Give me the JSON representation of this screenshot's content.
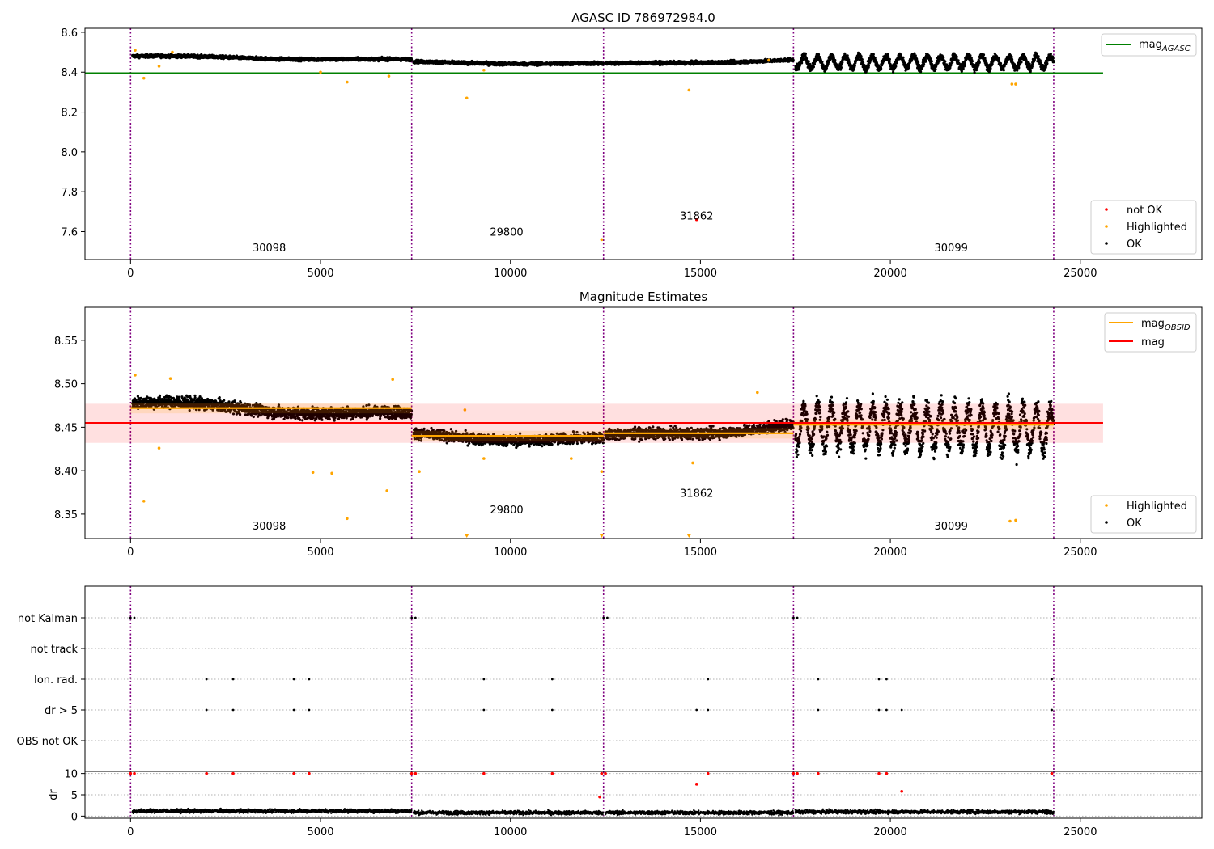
{
  "chart_data": [
    {
      "type": "scatter",
      "title": "AGASC ID 786972984.0",
      "xlim": [
        -1200,
        28200
      ],
      "ylim": [
        7.46,
        8.62
      ],
      "xticks": [
        0,
        5000,
        10000,
        15000,
        20000,
        25000
      ],
      "yticks": [
        7.6,
        7.8,
        8.0,
        8.2,
        8.4,
        8.6
      ],
      "ytick_labels": [
        "7.6",
        "7.8",
        "8.0",
        "8.2",
        "8.4",
        "8.6"
      ],
      "mag_agasc": 8.395,
      "mag_agasc_x": [
        -1200,
        25600
      ],
      "obsid_boundaries": [
        0,
        7400,
        12450,
        17450,
        24300
      ],
      "obsid_labels": [
        {
          "x": 3650,
          "y": 7.5,
          "text": "30098"
        },
        {
          "x": 9900,
          "y": 7.58,
          "text": "29800"
        },
        {
          "x": 14900,
          "y": 7.66,
          "text": "31862"
        },
        {
          "x": 21600,
          "y": 7.5,
          "text": "30099"
        }
      ],
      "series": [
        {
          "name": "mag",
          "sub": "AGASC",
          "kind": "line",
          "color": "#008000"
        },
        {
          "name": "not OK",
          "kind": "points",
          "color": "#ff0000",
          "points": [
            [
              14900,
              7.66
            ]
          ]
        },
        {
          "name": "Highlighted",
          "kind": "points",
          "color": "#ffa500",
          "points": [
            [
              120,
              8.51
            ],
            [
              350,
              8.37
            ],
            [
              750,
              8.43
            ],
            [
              1100,
              8.5
            ],
            [
              5000,
              8.4
            ],
            [
              5700,
              8.35
            ],
            [
              6800,
              8.38
            ],
            [
              8850,
              8.27
            ],
            [
              9300,
              8.41
            ],
            [
              12400,
              7.56
            ],
            [
              14700,
              8.31
            ],
            [
              16800,
              8.46
            ],
            [
              23200,
              8.34
            ],
            [
              23300,
              8.34
            ]
          ]
        },
        {
          "name": "OK",
          "kind": "trend",
          "color": "#000000",
          "segments": [
            {
              "x0": 50,
              "x1": 7400,
              "y0": 8.48,
              "y1": 8.46,
              "spread": 0.025
            },
            {
              "x0": 7450,
              "x1": 12450,
              "y0": 8.45,
              "y1": 8.44,
              "spread": 0.025
            },
            {
              "x0": 12500,
              "x1": 17450,
              "y0": 8.44,
              "y1": 8.46,
              "spread": 0.025
            },
            {
              "x0": 17500,
              "x1": 24300,
              "y0": 8.45,
              "y1": 8.45,
              "spread": 0.05,
              "oscillate": true
            }
          ]
        }
      ],
      "legend_top": [
        {
          "label": "mag",
          "sub": "AGASC",
          "color": "#008000"
        }
      ],
      "legend_bottom": [
        {
          "label": "not OK",
          "color": "#ff0000"
        },
        {
          "label": "Highlighted",
          "color": "#ffa500"
        },
        {
          "label": "OK",
          "color": "#000000"
        }
      ]
    },
    {
      "type": "scatter",
      "title": "Magnitude Estimates",
      "xlim": [
        -1200,
        28200
      ],
      "ylim": [
        8.322,
        8.588
      ],
      "xticks": [
        0,
        5000,
        10000,
        15000,
        20000,
        25000
      ],
      "yticks": [
        8.35,
        8.4,
        8.45,
        8.5,
        8.55
      ],
      "ytick_labels": [
        "8.35",
        "8.40",
        "8.45",
        "8.50",
        "8.55"
      ],
      "mag": 8.455,
      "mag_band": [
        8.432,
        8.477
      ],
      "mag_x": [
        -1200,
        25600
      ],
      "mag_obsid": [
        {
          "x0": 0,
          "x1": 7400,
          "y": 8.472
        },
        {
          "x0": 7400,
          "x1": 12450,
          "y": 8.44
        },
        {
          "x0": 12450,
          "x1": 17450,
          "y": 8.443
        },
        {
          "x0": 17450,
          "x1": 24300,
          "y": 8.453
        }
      ],
      "obsid_boundaries": [
        0,
        7400,
        12450,
        17450,
        24300
      ],
      "obsid_labels": [
        {
          "x": 3650,
          "y": 8.332,
          "text": "30098"
        },
        {
          "x": 9900,
          "y": 8.351,
          "text": "29800"
        },
        {
          "x": 14900,
          "y": 8.37,
          "text": "31862"
        },
        {
          "x": 21600,
          "y": 8.332,
          "text": "30099"
        }
      ],
      "series": [
        {
          "name": "Highlighted",
          "kind": "points",
          "color": "#ffa500",
          "points": [
            [
              120,
              8.51
            ],
            [
              350,
              8.365
            ],
            [
              750,
              8.426
            ],
            [
              1050,
              8.506
            ],
            [
              4800,
              8.398
            ],
            [
              5300,
              8.397
            ],
            [
              5700,
              8.345
            ],
            [
              6750,
              8.377
            ],
            [
              6900,
              8.505
            ],
            [
              7600,
              8.399
            ],
            [
              8800,
              8.47
            ],
            [
              9300,
              8.414
            ],
            [
              11600,
              8.414
            ],
            [
              12400,
              8.399
            ],
            [
              14800,
              8.409
            ],
            [
              16500,
              8.49
            ],
            [
              23150,
              8.342
            ],
            [
              23300,
              8.343
            ]
          ]
        },
        {
          "name": "OK",
          "kind": "trend",
          "color": "#000000",
          "segments": [
            {
              "x0": 50,
              "x1": 7400,
              "y0": 8.478,
              "y1": 8.463,
              "spread": 0.022
            },
            {
              "x0": 7450,
              "x1": 12450,
              "y0": 8.44,
              "y1": 8.435,
              "spread": 0.02
            },
            {
              "x0": 12500,
              "x1": 17450,
              "y0": 8.438,
              "y1": 8.452,
              "spread": 0.02
            },
            {
              "x0": 17500,
              "x1": 24300,
              "y0": 8.452,
              "y1": 8.448,
              "spread": 0.04,
              "oscillate": true
            }
          ]
        }
      ],
      "legend_top": [
        {
          "label": "mag",
          "sub": "OBSID",
          "color": "#ffa500"
        },
        {
          "label": "mag",
          "sub": "",
          "color": "#ff0000"
        }
      ],
      "legend_bottom": [
        {
          "label": "Highlighted",
          "color": "#ffa500"
        },
        {
          "label": "OK",
          "color": "#000000"
        }
      ]
    },
    {
      "type": "scatter",
      "title": "",
      "xlim": [
        -1200,
        28200
      ],
      "categories": [
        "not Kalman",
        "not track",
        "Ion. rad.",
        "dr > 5",
        "OBS not OK"
      ],
      "flag_points": {
        "not Kalman": [
          0,
          100,
          7400,
          7500,
          12450,
          12550,
          17450,
          17550
        ],
        "not track": [],
        "Ion. rad.": [
          2000,
          2700,
          4300,
          4700,
          9300,
          11100,
          15200,
          18100,
          19700,
          19900,
          24250
        ],
        "dr > 5": [
          2000,
          2700,
          4300,
          4700,
          9300,
          11100,
          14900,
          15200,
          18100,
          19700,
          19900,
          20300,
          24250
        ],
        "OBS not OK": []
      },
      "obsid_boundaries": [
        0,
        7400,
        12450,
        17450,
        24300
      ]
    },
    {
      "type": "scatter",
      "title": "",
      "xlim": [
        -1200,
        28200
      ],
      "ylim": [
        -0.5,
        10.5
      ],
      "xticks": [
        0,
        5000,
        10000,
        15000,
        20000,
        25000
      ],
      "yticks": [
        0,
        5,
        10
      ],
      "ytick_labels": [
        "0",
        "5",
        "10"
      ],
      "ylabel": "dr",
      "dr_red": [
        [
          0,
          10
        ],
        [
          100,
          10
        ],
        [
          2000,
          10
        ],
        [
          2700,
          10
        ],
        [
          4300,
          10
        ],
        [
          4700,
          10
        ],
        [
          7400,
          10
        ],
        [
          7500,
          10
        ],
        [
          9300,
          10
        ],
        [
          11100,
          10
        ],
        [
          12400,
          10
        ],
        [
          12500,
          10
        ],
        [
          14900,
          7.5
        ],
        [
          15200,
          10
        ],
        [
          17450,
          10
        ],
        [
          17550,
          10
        ],
        [
          18100,
          10
        ],
        [
          19700,
          10
        ],
        [
          19900,
          10
        ],
        [
          20300,
          5.8
        ],
        [
          24250,
          10
        ],
        [
          12350,
          4.5
        ]
      ],
      "dr_levels": [
        {
          "x0": 50,
          "x1": 7400,
          "y": 1.2
        },
        {
          "x0": 7450,
          "x1": 12450,
          "y": 0.8
        },
        {
          "x0": 12500,
          "x1": 17450,
          "y": 0.8
        },
        {
          "x0": 17500,
          "x1": 24300,
          "y": 1.0
        }
      ],
      "obsid_boundaries": [
        0,
        7400,
        12450,
        17450,
        24300
      ]
    }
  ]
}
